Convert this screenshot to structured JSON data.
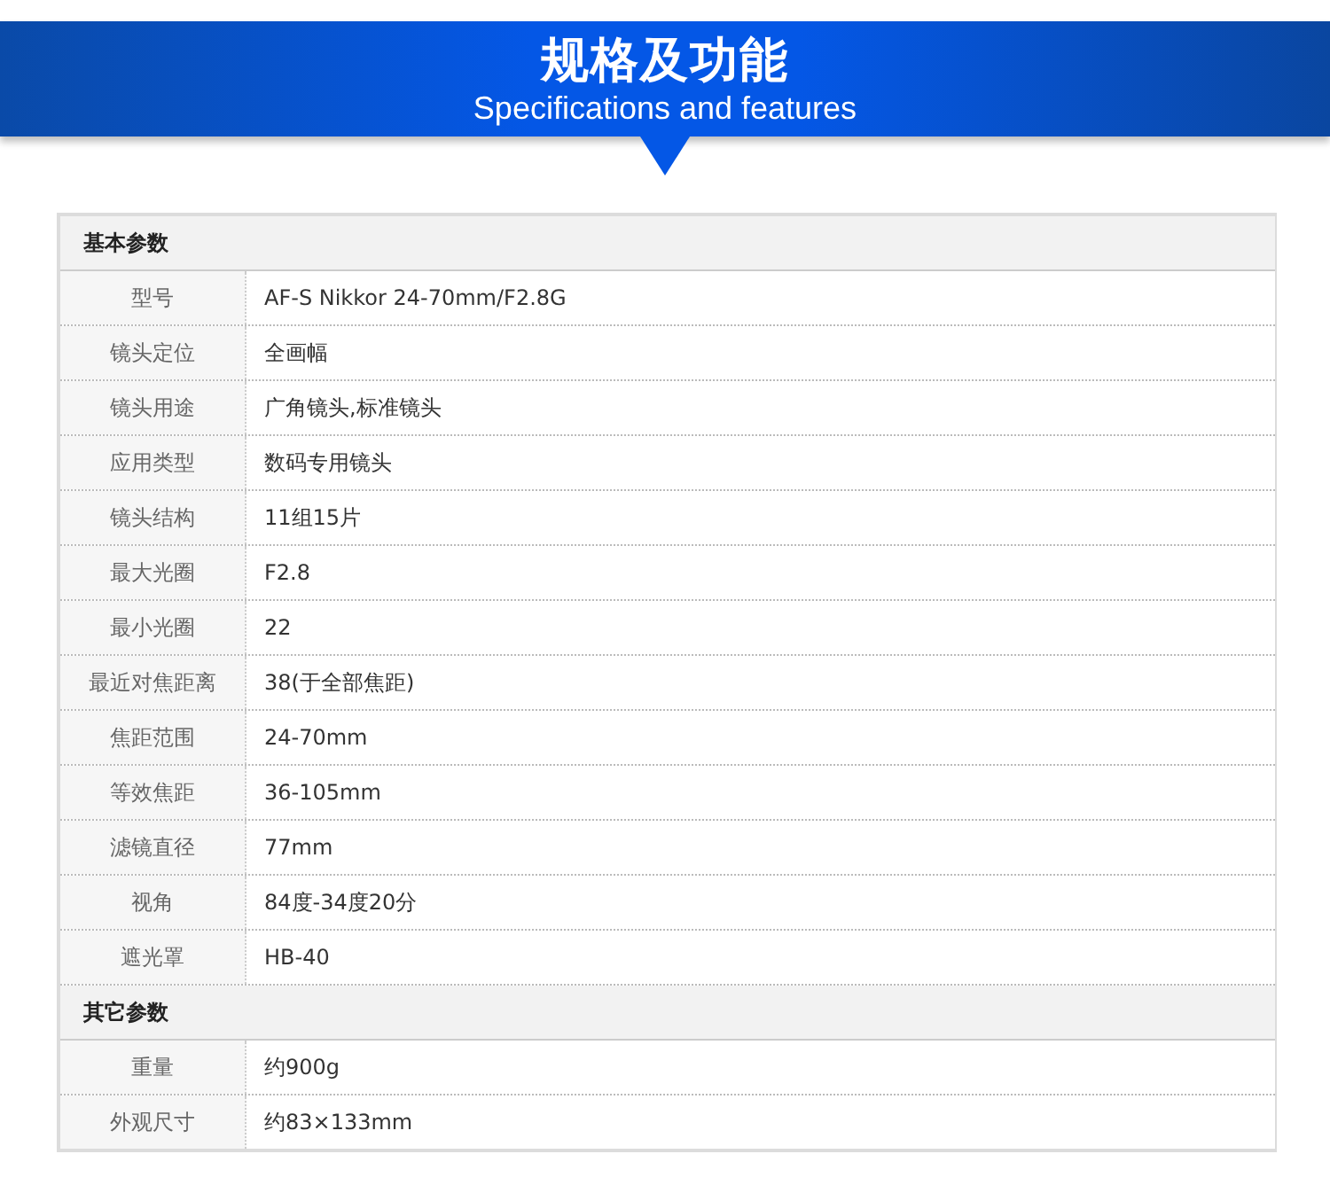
{
  "banner": {
    "title": "规格及功能",
    "subtitle": "Specifications and features"
  },
  "sections": [
    {
      "title": "基本参数",
      "rows": [
        {
          "label": "型号",
          "value": "AF-S Nikkor 24-70mm/F2.8G"
        },
        {
          "label": "镜头定位",
          "value": "全画幅"
        },
        {
          "label": "镜头用途",
          "value": "广角镜头,标准镜头"
        },
        {
          "label": "应用类型",
          "value": "数码专用镜头"
        },
        {
          "label": "镜头结构",
          "value": "11组15片"
        },
        {
          "label": "最大光圈",
          "value": "F2.8"
        },
        {
          "label": "最小光圈",
          "value": "22"
        },
        {
          "label": "最近对焦距离",
          "value": "38(于全部焦距)"
        },
        {
          "label": "焦距范围",
          "value": "24-70mm"
        },
        {
          "label": "等效焦距",
          "value": "36-105mm"
        },
        {
          "label": "滤镜直径",
          "value": "77mm"
        },
        {
          "label": "视角",
          "value": "84度-34度20分"
        },
        {
          "label": "遮光罩",
          "value": "HB-40"
        }
      ]
    },
    {
      "title": "其它参数",
      "rows": [
        {
          "label": "重量",
          "value": "约900g"
        },
        {
          "label": "外观尺寸",
          "value": "约83×133mm"
        }
      ]
    }
  ]
}
